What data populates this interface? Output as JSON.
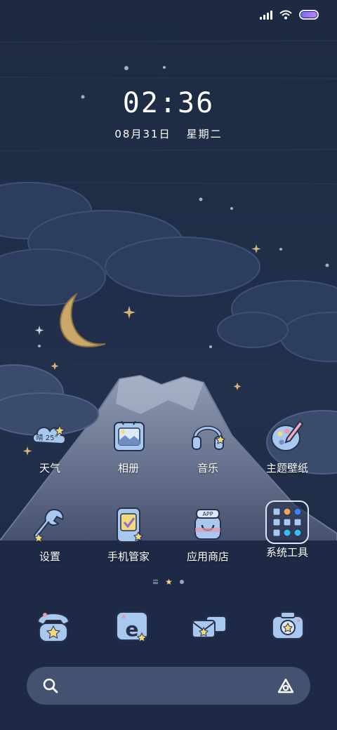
{
  "status_bar": {
    "signal_icon": "signal-bars-icon",
    "wifi_icon": "wifi-icon",
    "battery_icon": "battery-icon",
    "battery_color": "#9a72ff"
  },
  "lockclock": {
    "time": "02:36",
    "date": "08月31日",
    "weekday": "星期二"
  },
  "apps": [
    {
      "label": "天气",
      "icon": "weather-cloud-icon",
      "badge": "晴 25°"
    },
    {
      "label": "相册",
      "icon": "photo-album-icon"
    },
    {
      "label": "音乐",
      "icon": "headphones-icon"
    },
    {
      "label": "主题壁纸",
      "icon": "paint-palette-icon"
    },
    {
      "label": "设置",
      "icon": "wrench-icon"
    },
    {
      "label": "手机管家",
      "icon": "phone-shield-icon"
    },
    {
      "label": "应用商店",
      "icon": "app-store-bag-icon",
      "badge": "APP"
    },
    {
      "label": "系统工具",
      "icon": "system-tools-folder-icon"
    }
  ],
  "dock": [
    {
      "icon": "telephone-icon"
    },
    {
      "icon": "browser-e-icon"
    },
    {
      "icon": "messages-envelope-icon"
    },
    {
      "icon": "camera-icon"
    }
  ],
  "page_indicator": {
    "pages": 3,
    "current": 2
  },
  "search": {
    "search_icon": "search-icon",
    "assistant_icon": "assistant-icon"
  },
  "colors": {
    "sky": "#1c2a44",
    "icon_fill": "#a9c8ef",
    "icon_stroke": "#26324e",
    "star": "#f3d97a",
    "moon": "#c9a86a"
  }
}
